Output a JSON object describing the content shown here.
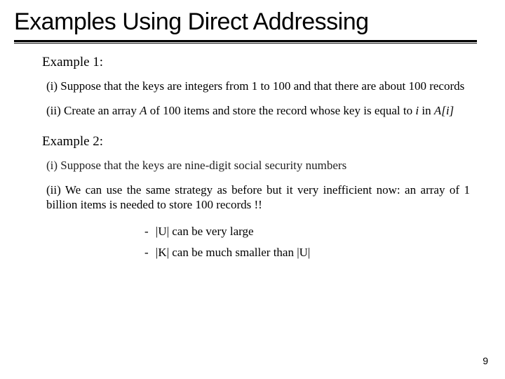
{
  "title": "Examples Using Direct Addressing",
  "example1": {
    "label": "Example 1:",
    "item_i": "(i) Suppose that the keys are integers from 1 to 100 and that there are about 100 records",
    "item_ii_pre": "(ii) Create an array ",
    "item_ii_A": "A",
    "item_ii_mid": " of 100 items and store the record whose key is equal to ",
    "item_ii_i": "i",
    "item_ii_in": " in ",
    "item_ii_Ai": "A[i]"
  },
  "example2": {
    "label": "Example 2:",
    "item_i": "(i) Suppose that the keys are nine-digit social security numbers",
    "item_ii": "(ii) We can use the same strategy as before but it very inefficient now: an array of 1 billion items is needed to store 100 records !!",
    "sub_U_pre": "|U|",
    "sub_U_post": " can be very large",
    "sub_K_pre": "|K|",
    "sub_K_mid": " can be much smaller than ",
    "sub_K_post": "|U|"
  },
  "page_number": "9"
}
